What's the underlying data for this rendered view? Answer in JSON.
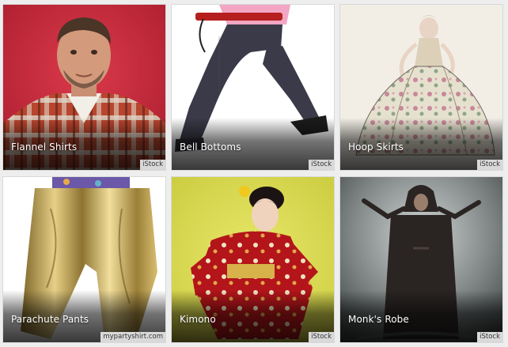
{
  "tiles": [
    {
      "label": "Flannel Shirts",
      "credit": "iStock"
    },
    {
      "label": "Bell Bottoms",
      "credit": "iStock"
    },
    {
      "label": "Hoop Skirts",
      "credit": "iStock"
    },
    {
      "label": "Parachute Pants",
      "credit": "mypartyshirt.com"
    },
    {
      "label": "Kimono",
      "credit": "iStock"
    },
    {
      "label": "Monk's Robe",
      "credit": "iStock"
    }
  ]
}
